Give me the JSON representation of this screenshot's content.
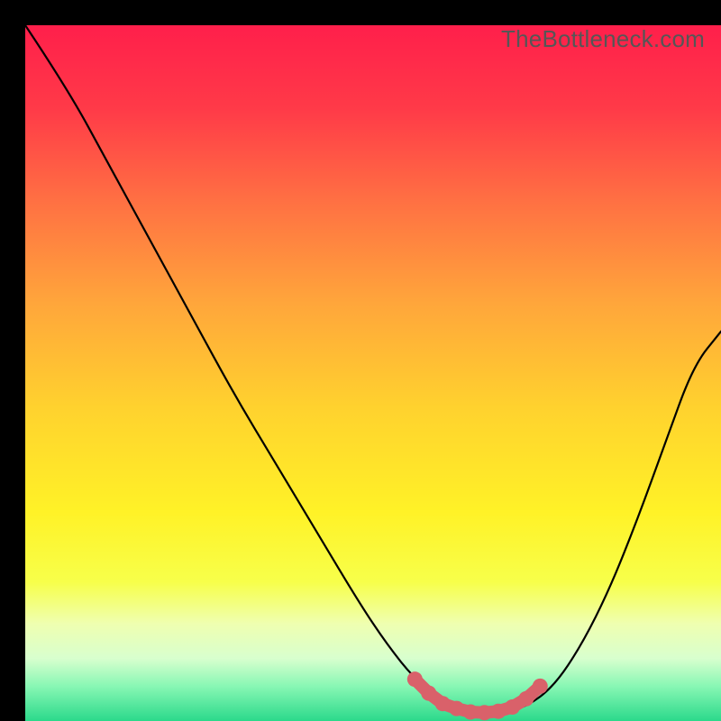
{
  "watermark": "TheBottleneck.com",
  "chart_data": {
    "type": "line",
    "title": "",
    "xlabel": "",
    "ylabel": "",
    "xlim": [
      0,
      100
    ],
    "ylim": [
      0,
      100
    ],
    "series": [
      {
        "name": "bottleneck-curve",
        "x": [
          0,
          6,
          12,
          18,
          24,
          30,
          36,
          42,
          48,
          52,
          56,
          60,
          64,
          68,
          72,
          76,
          80,
          84,
          88,
          92,
          96,
          100
        ],
        "y": [
          100,
          91,
          80,
          69,
          58,
          47,
          37,
          27,
          17,
          11,
          6,
          3,
          1,
          1,
          2,
          5,
          11,
          19,
          29,
          40,
          51,
          56
        ]
      }
    ],
    "markers": {
      "name": "optimal-range",
      "x": [
        56,
        58,
        60,
        62,
        64,
        66,
        68,
        70,
        72,
        74
      ],
      "y": [
        6,
        4,
        2.5,
        1.8,
        1.3,
        1.2,
        1.4,
        2.0,
        3.2,
        5.0
      ]
    },
    "gradient_stops": [
      {
        "offset": 0.0,
        "color": "#ff1f4b"
      },
      {
        "offset": 0.12,
        "color": "#ff3a48"
      },
      {
        "offset": 0.25,
        "color": "#ff6f43"
      },
      {
        "offset": 0.4,
        "color": "#ffa63b"
      },
      {
        "offset": 0.55,
        "color": "#ffd22e"
      },
      {
        "offset": 0.7,
        "color": "#fff227"
      },
      {
        "offset": 0.8,
        "color": "#f7ff4a"
      },
      {
        "offset": 0.86,
        "color": "#efffb0"
      },
      {
        "offset": 0.91,
        "color": "#d8ffce"
      },
      {
        "offset": 0.95,
        "color": "#88f7b4"
      },
      {
        "offset": 1.0,
        "color": "#2bd98b"
      }
    ]
  }
}
